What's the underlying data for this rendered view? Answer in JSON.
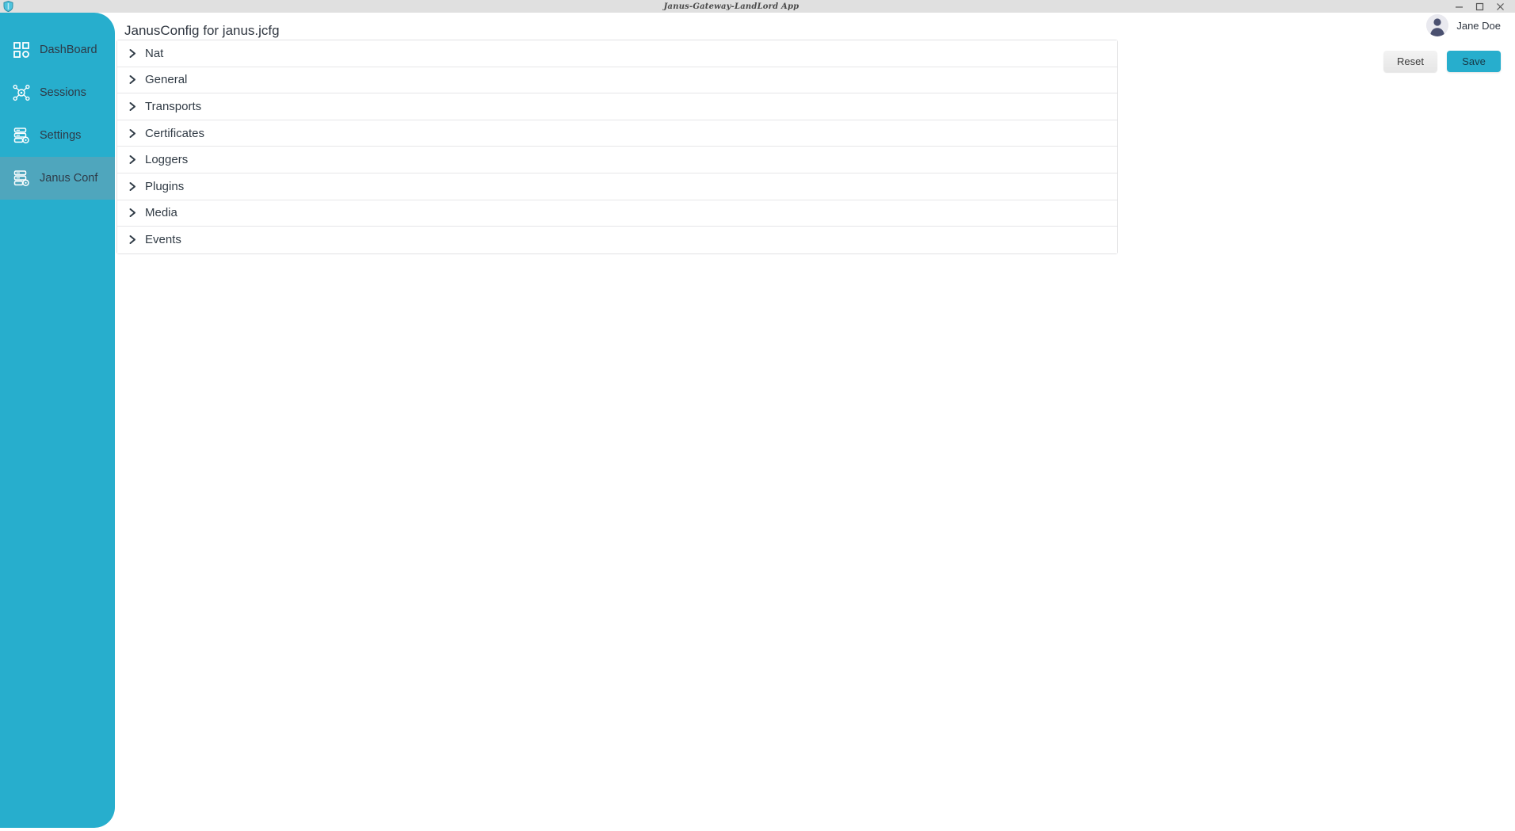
{
  "window": {
    "title": "Janus-Gateway-LandLord App",
    "app_icon": "shield-icon",
    "controls": {
      "minimize": "−",
      "maximize": "❐",
      "close": "✕"
    }
  },
  "sidebar": {
    "accent_color": "#27aecd",
    "active_item_color": "#4fa6bd",
    "items": [
      {
        "label": "DashBoard",
        "icon": "grid-dashboard-icon",
        "active": false
      },
      {
        "label": "Sessions",
        "icon": "network-sessions-icon",
        "active": false
      },
      {
        "label": "Settings",
        "icon": "server-gear-icon",
        "active": false
      },
      {
        "label": "Janus Conf",
        "icon": "server-config-icon",
        "active": true
      }
    ]
  },
  "header": {
    "page_title": "JanusConfig for janus.jcfg",
    "user": {
      "name": "Jane Doe",
      "avatar": "user-avatar-icon"
    }
  },
  "toolbar": {
    "reset_label": "Reset",
    "save_label": "Save",
    "save_color": "#27aecd"
  },
  "accordion": {
    "sections": [
      {
        "label": "Nat",
        "expanded": false
      },
      {
        "label": "General",
        "expanded": false
      },
      {
        "label": "Transports",
        "expanded": false
      },
      {
        "label": "Certificates",
        "expanded": false
      },
      {
        "label": "Loggers",
        "expanded": false
      },
      {
        "label": "Plugins",
        "expanded": false
      },
      {
        "label": "Media",
        "expanded": false
      },
      {
        "label": "Events",
        "expanded": false
      }
    ]
  }
}
